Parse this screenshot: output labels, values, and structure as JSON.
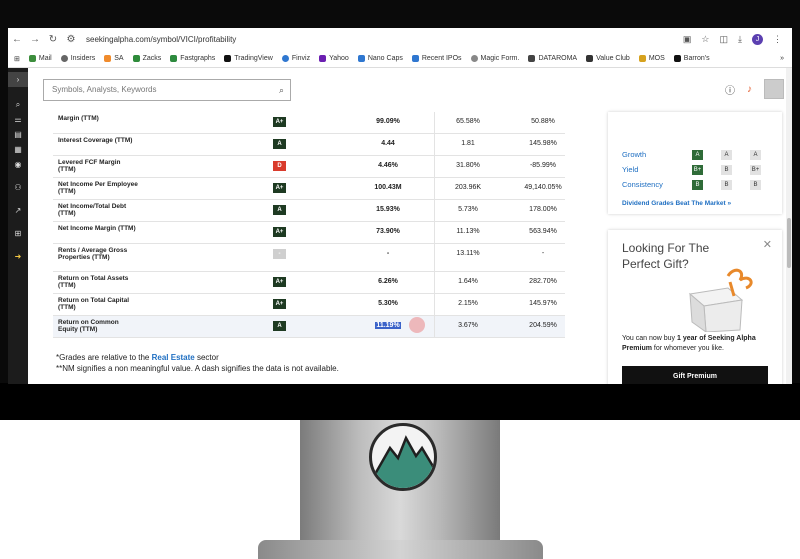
{
  "browser": {
    "url": "seekingalpha.com/symbol/VICI/profitability",
    "profile_initial": "J",
    "bookmarks": [
      "Mail",
      "Insiders",
      "SA",
      "Zacks",
      "Fastgraphs",
      "TradingView",
      "Finviz",
      "Yahoo",
      "Nano Caps",
      "Recent IPOs",
      "Magic Form.",
      "DATAROMA",
      "Value Club",
      "MOS",
      "Barron's"
    ]
  },
  "header": {
    "search_placeholder": "Symbols, Analysts, Keywords"
  },
  "table": {
    "rows": [
      {
        "metric": "Margin (TTM)",
        "grade": "A+",
        "v1": "99.09%",
        "v2": "65.58%",
        "v3": "50.88%"
      },
      {
        "metric": "Interest Coverage (TTM)",
        "grade": "A",
        "v1": "4.44",
        "v2": "1.81",
        "v3": "145.98%"
      },
      {
        "metric": "Levered FCF Margin (TTM)",
        "grade": "D",
        "v1": "4.46%",
        "v2": "31.80%",
        "v3": "-85.99%"
      },
      {
        "metric": "Net Income Per Employee (TTM)",
        "grade": "A+",
        "v1": "100.43M",
        "v2": "203.96K",
        "v3": "49,140.05%"
      },
      {
        "metric": "Net Income/Total Debt (TTM)",
        "grade": "A",
        "v1": "15.93%",
        "v2": "5.73%",
        "v3": "178.00%"
      },
      {
        "metric": "Net Income Margin (TTM)",
        "grade": "A+",
        "v1": "73.90%",
        "v2": "11.13%",
        "v3": "563.94%"
      },
      {
        "metric": "Rents / Average Gross Properties (TTM)",
        "grade": "-",
        "v1": "-",
        "v2": "13.11%",
        "v3": "-"
      },
      {
        "metric": "Return on Total Assets (TTM)",
        "grade": "A+",
        "v1": "6.26%",
        "v2": "1.64%",
        "v3": "282.70%"
      },
      {
        "metric": "Return on Total Capital (TTM)",
        "grade": "A+",
        "v1": "5.30%",
        "v2": "2.15%",
        "v3": "145.97%"
      },
      {
        "metric": "Return on Common Equity (TTM)",
        "grade": "A",
        "v1": "11.19%",
        "v2": "3.67%",
        "v3": "204.59%"
      }
    ],
    "note1_prefix": "*Grades are relative to the ",
    "note1_link": "Real Estate",
    "note1_suffix": " sector",
    "note2": "**NM signifies a non meaningful value. A dash signifies the data is not available."
  },
  "grades_card": {
    "rows": [
      {
        "label": "Growth",
        "grades": [
          "A",
          "A",
          "A"
        ]
      },
      {
        "label": "Yield",
        "grades": [
          "B+",
          "B",
          "B+"
        ]
      },
      {
        "label": "Consistency",
        "grades": [
          "B",
          "B",
          "B"
        ]
      }
    ],
    "link": "Dividend Grades Beat The Market »"
  },
  "gift_card": {
    "title": "Looking For The Perfect Gift?",
    "text_1": "You can now buy ",
    "text_bold": "1 year of Seeking Alpha Premium",
    "text_2": " for whomever you like.",
    "button": "Gift Premium"
  },
  "colors": {
    "grade_dark": "#1e3a22",
    "grade_red": "#d93b2c",
    "grade_green": "#2f6b38",
    "link_blue": "#1f6fc2"
  }
}
